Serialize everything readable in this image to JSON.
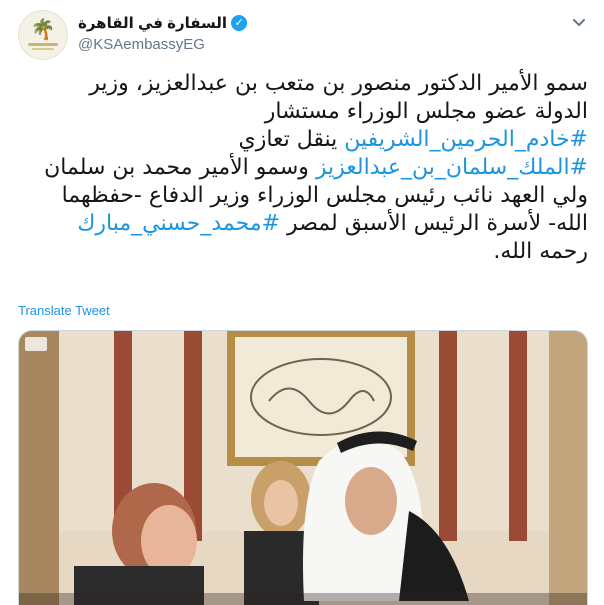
{
  "account": {
    "display_name": "السفارة في القاهرة",
    "handle": "@KSAembassyEG",
    "verified_icon": "verified-badge-icon"
  },
  "tweet": {
    "lines": [
      [
        {
          "text": "سمو الأمير الدكتور منصور بن متعب بن عبدالعزيز، وزير",
          "tag": false
        }
      ],
      [
        {
          "text": "الدولة عضو مجلس الوزراء مستشار",
          "tag": false
        }
      ],
      [
        {
          "text": "#خادم_الحرمين_الشريفين",
          "tag": true
        },
        {
          "text": " ينقل تعازي",
          "tag": false
        }
      ],
      [
        {
          "text": "#الملك_سلمان_بن_عبدالعزيز",
          "tag": true
        },
        {
          "text": " وسمو الأمير محمد بن سلمان",
          "tag": false
        }
      ],
      [
        {
          "text": "ولي العهد نائب رئيس مجلس الوزراء وزير الدفاع -حفظهما",
          "tag": false
        }
      ],
      [
        {
          "text": "الله- لأسرة الرئيس الأسبق لمصر ",
          "tag": false
        },
        {
          "text": "#محمد_حسني_مبارك",
          "tag": true
        }
      ],
      [
        {
          "text": "رحمه الله.",
          "tag": false
        }
      ]
    ],
    "translate_label": "Translate Tweet"
  },
  "colors": {
    "link": "#1b95e0",
    "verified": "#1da1f2",
    "secondary_text": "#657786",
    "border": "#ccd6dd"
  },
  "icons": {
    "caret": "chevron-down-icon",
    "avatar_emblem": "palm-swords-emblem-icon"
  }
}
